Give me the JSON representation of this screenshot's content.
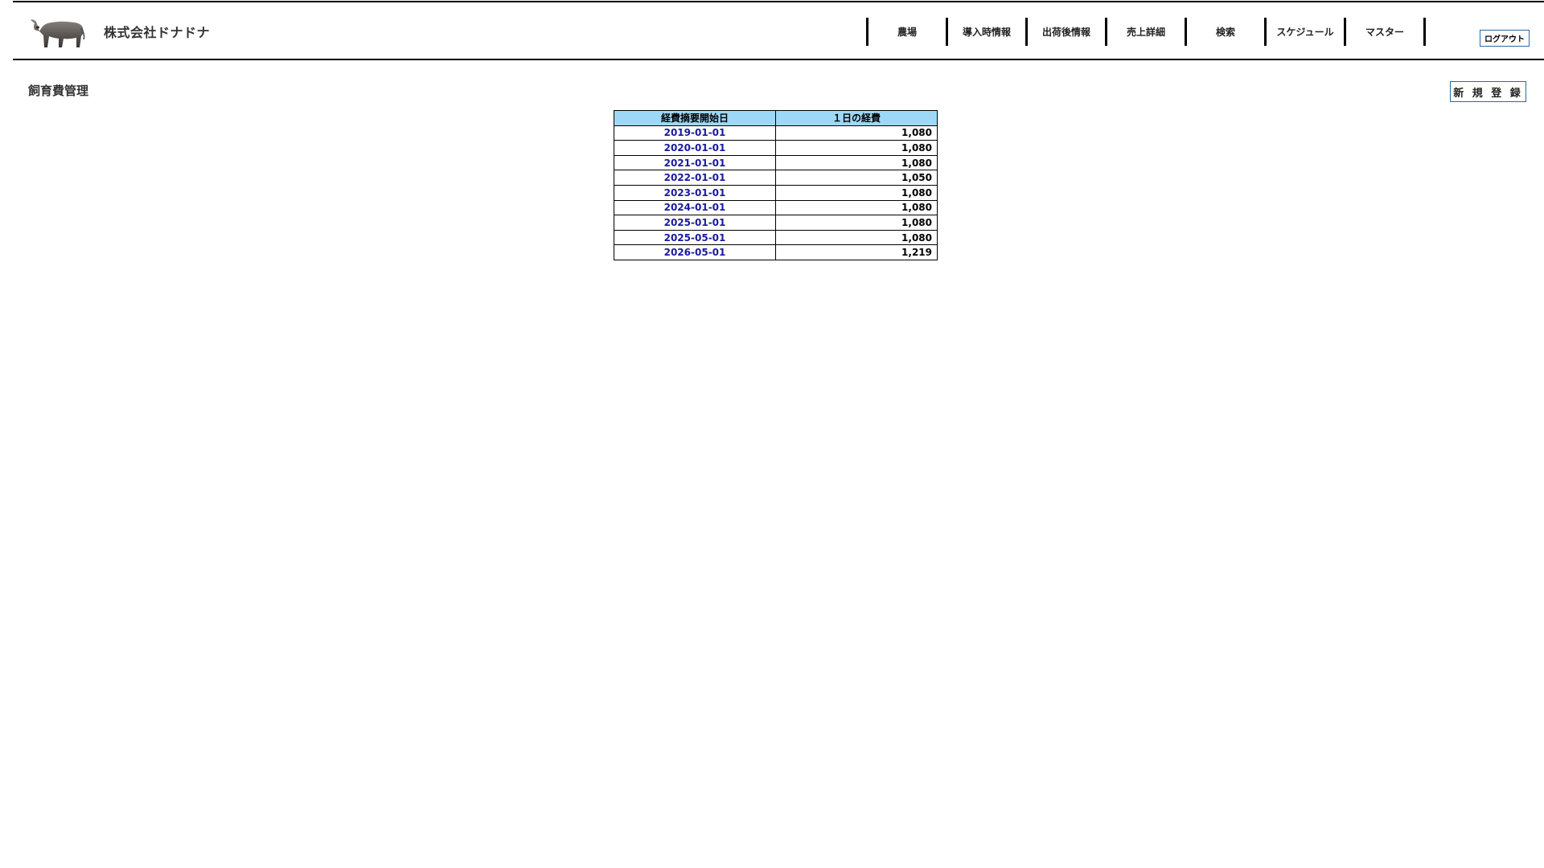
{
  "company": {
    "name": "株式会社ドナドナ"
  },
  "nav": {
    "items": [
      "農場",
      "導入時情報",
      "出荷後情報",
      "売上詳細",
      "検索",
      "スケジュール",
      "マスター"
    ]
  },
  "header": {
    "logout_label": "ログアウト"
  },
  "page": {
    "title": "飼育費管理",
    "new_button_label": "新 規 登 録"
  },
  "table": {
    "headers": [
      "経費摘要開始日",
      "１日の経費"
    ],
    "rows": [
      {
        "date": "2019-01-01",
        "cost": "1,080"
      },
      {
        "date": "2020-01-01",
        "cost": "1,080"
      },
      {
        "date": "2021-01-01",
        "cost": "1,080"
      },
      {
        "date": "2022-01-01",
        "cost": "1,050"
      },
      {
        "date": "2023-01-01",
        "cost": "1,080"
      },
      {
        "date": "2024-01-01",
        "cost": "1,080"
      },
      {
        "date": "2025-01-01",
        "cost": "1,080"
      },
      {
        "date": "2025-05-01",
        "cost": "1,080"
      },
      {
        "date": "2026-05-01",
        "cost": "1,219"
      }
    ]
  },
  "colors": {
    "header_cell": "#9ed8f7",
    "link": "#1a1a9c",
    "button_border": "#2a6aa8"
  }
}
